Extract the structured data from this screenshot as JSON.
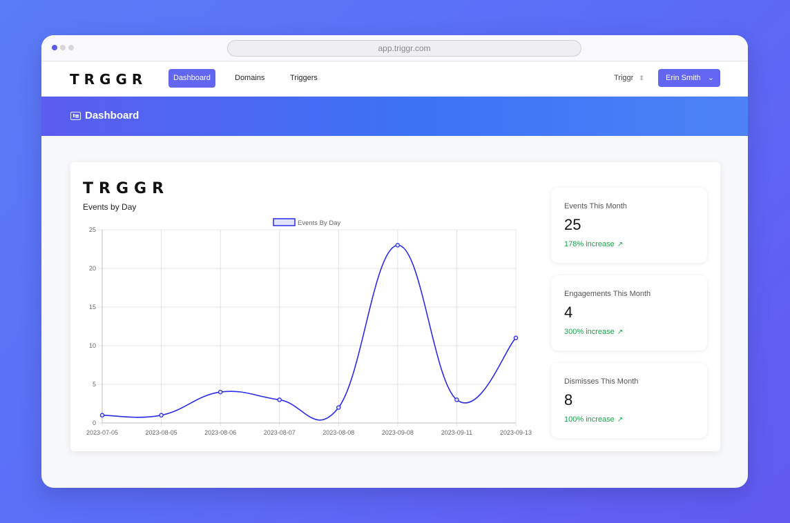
{
  "browser": {
    "url": "app.triggr.com"
  },
  "nav": {
    "logo": "TRGGR",
    "links": [
      "Dashboard",
      "Domains",
      "Triggers"
    ],
    "org": "Triggr",
    "user": "Erin Smith"
  },
  "banner": {
    "title": "Dashboard"
  },
  "card": {
    "logo": "TRGGR",
    "chart_title": "Events by Day"
  },
  "chart_data": {
    "type": "line",
    "categories": [
      "2023-07-05",
      "2023-08-05",
      "2023-08-06",
      "2023-08-07",
      "2023-08-08",
      "2023-09-08",
      "2023-09-11",
      "2023-09-13"
    ],
    "series": [
      {
        "name": "Events By Day",
        "values": [
          1,
          1,
          4,
          3,
          2,
          23,
          3,
          11
        ]
      }
    ],
    "ylim": [
      0,
      25
    ],
    "yticks": [
      0,
      5,
      10,
      15,
      20,
      25
    ],
    "line_color": "#2a2ae8",
    "grid": true,
    "legend_position": "top",
    "smooth": true
  },
  "stats": [
    {
      "label": "Events This Month",
      "value": "25",
      "change": "178% increase"
    },
    {
      "label": "Engagements This Month",
      "value": "4",
      "change": "300% increase"
    },
    {
      "label": "Dismisses This Month",
      "value": "8",
      "change": "100% increase"
    }
  ],
  "colors": {
    "accent": "#6366f1",
    "positive": "#1aa34a"
  }
}
